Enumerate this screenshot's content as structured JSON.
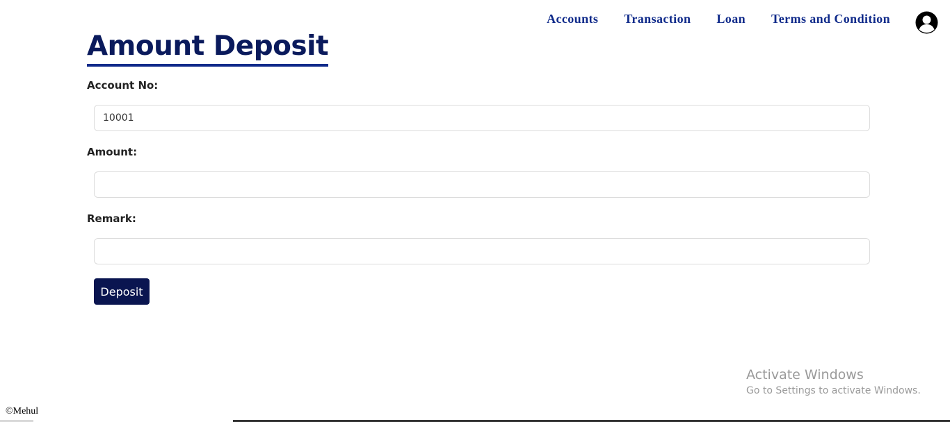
{
  "nav": {
    "items": [
      {
        "label": "Accounts"
      },
      {
        "label": "Transaction"
      },
      {
        "label": "Loan"
      },
      {
        "label": "Terms and Condition"
      }
    ]
  },
  "page": {
    "title": "Amount Deposit"
  },
  "form": {
    "account_no_label": "Account No:",
    "account_no_value": "10001",
    "amount_label": "Amount:",
    "amount_value": "",
    "remark_label": "Remark:",
    "remark_value": "",
    "deposit_label": "Deposit"
  },
  "footer": {
    "copyright": "©Mehul"
  },
  "watermark": {
    "title": "Activate Windows",
    "subtitle": "Go to Settings to activate Windows."
  },
  "colors": {
    "nav_link": "#0f2a8a",
    "title": "#0a1a5c",
    "button": "#0a1550"
  },
  "icons": {
    "avatar": "user-circle-icon"
  }
}
